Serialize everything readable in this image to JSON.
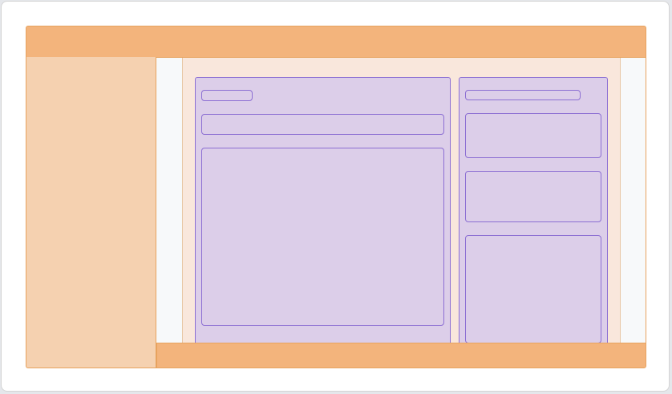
{
  "diagram": {
    "kind": "wireframe-layout",
    "colors": {
      "header": "#f3b47c",
      "sidebar": "#f5d1b0",
      "content": "#f9e7dc",
      "gutter": "#f7f9fa",
      "panel": "#dccee9",
      "panel_border": "#8c6fd3",
      "region_border": "#e7a35f"
    }
  }
}
